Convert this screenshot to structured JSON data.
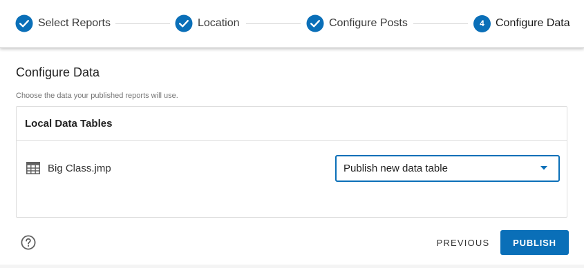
{
  "stepper": {
    "steps": [
      {
        "label": "Select Reports",
        "status": "complete",
        "icon": "check-circle-icon"
      },
      {
        "label": "Location",
        "status": "complete",
        "icon": "check-circle-icon"
      },
      {
        "label": "Configure Posts",
        "status": "complete",
        "icon": "check-circle-icon"
      },
      {
        "label": "Configure Data",
        "status": "active",
        "number": "4"
      }
    ]
  },
  "main": {
    "title": "Configure Data",
    "subtitle": "Choose the data your published reports will use."
  },
  "panel": {
    "header": "Local Data Tables",
    "rows": [
      {
        "icon": "table-icon",
        "name": "Big Class.jmp",
        "selection": "Publish new data table"
      }
    ]
  },
  "footer": {
    "help_icon": "help-circle-icon",
    "previous_label": "PREVIOUS",
    "publish_label": "PUBLISH"
  },
  "colors": {
    "accent": "#0a6fb8",
    "text": "#212121",
    "muted": "#757575",
    "border": "#dddddd"
  }
}
